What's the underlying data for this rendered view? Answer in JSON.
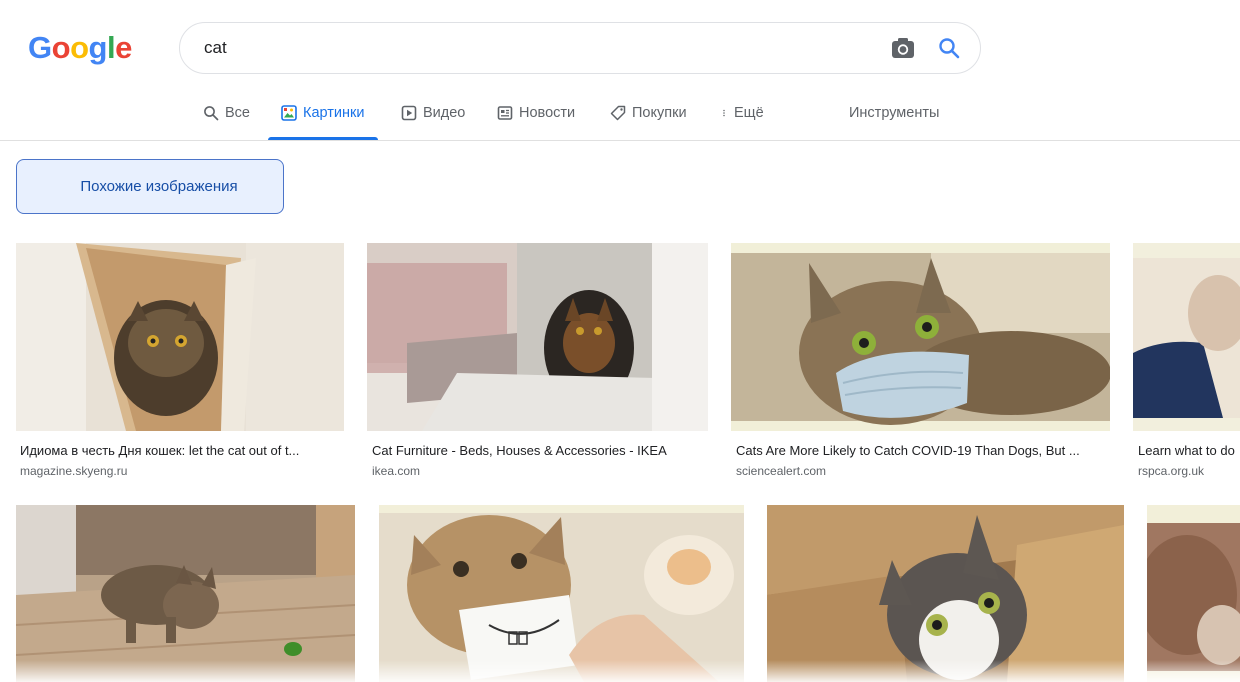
{
  "logo": {
    "text": "Google"
  },
  "search": {
    "query": "cat",
    "camera_icon": "camera-icon",
    "search_icon": "search-icon"
  },
  "tabs": [
    {
      "label": "Все",
      "icon": "search-icon",
      "active": false
    },
    {
      "label": "Картинки",
      "icon": "image-icon",
      "active": true
    },
    {
      "label": "Видео",
      "icon": "play-icon",
      "active": false
    },
    {
      "label": "Новости",
      "icon": "news-icon",
      "active": false
    },
    {
      "label": "Покупки",
      "icon": "tag-icon",
      "active": false
    },
    {
      "label": "Ещё",
      "icon": "more-vert-icon",
      "active": false
    }
  ],
  "tools_label": "Инструменты",
  "related_chip": {
    "label": "Похожие изображения"
  },
  "results": [
    {
      "caption": "Идиома в честь Дня кошек: let the cat out of t...",
      "source": "magazine.skyeng.ru"
    },
    {
      "caption": "Cat Furniture - Beds, Houses & Accessories - IKEA",
      "source": "ikea.com"
    },
    {
      "caption": "Cats Are More Likely to Catch COVID-19 Than Dogs, But ...",
      "source": "sciencealert.com"
    },
    {
      "caption": "Learn what to do",
      "source": "rspca.org.uk"
    },
    {
      "caption": "",
      "source": ""
    },
    {
      "caption": "",
      "source": ""
    },
    {
      "caption": "",
      "source": ""
    },
    {
      "caption": "",
      "source": ""
    }
  ],
  "colors": {
    "accent": "#1a73e8",
    "chip_bg": "#e8f0fe",
    "chip_border": "#4b74c9"
  }
}
